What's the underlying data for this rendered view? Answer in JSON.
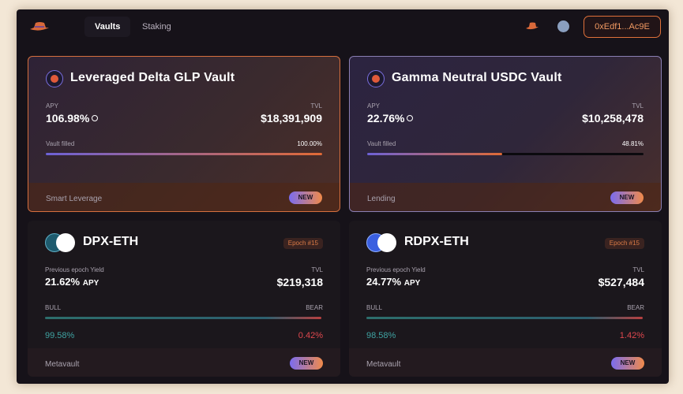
{
  "nav": {
    "tabs": [
      "Vaults",
      "Staking"
    ],
    "wallet": "0xEdf1...Ac9E",
    "icons": [
      "hat-logo-icon",
      "hat-icon",
      "network-icon"
    ]
  },
  "vaults": [
    {
      "title": "Leveraged Delta GLP Vault",
      "apy_label": "APY",
      "apy": "106.98%",
      "tvl_label": "TVL",
      "tvl": "$18,391,909",
      "filled_label": "Vault filled",
      "filled_pct": "100.00%",
      "filled_fraction": 1.0,
      "category": "Smart Leverage",
      "badge": "NEW"
    },
    {
      "title": "Gamma Neutral USDC Vault",
      "apy_label": "APY",
      "apy": "22.76%",
      "tvl_label": "TVL",
      "tvl": "$10,258,478",
      "filled_label": "Vault filled",
      "filled_pct": "48.81%",
      "filled_fraction": 0.4881,
      "category": "Lending",
      "badge": "NEW"
    }
  ],
  "dopex": [
    {
      "title": "DPX-ETH",
      "epoch": "Epoch #15",
      "yield_label": "Previous epoch Yield",
      "yield": "21.62%",
      "yield_unit": "APY",
      "tvl_label": "TVL",
      "tvl": "$219,318",
      "bull_label": "BULL",
      "bear_label": "BEAR",
      "bull_pct": "99.58%",
      "bear_pct": "0.42%",
      "category": "Metavault",
      "badge": "NEW"
    },
    {
      "title": "RDPX-ETH",
      "epoch": "Epoch #15",
      "yield_label": "Previous epoch Yield",
      "yield": "24.77%",
      "yield_unit": "APY",
      "tvl_label": "TVL",
      "tvl": "$527,484",
      "bull_label": "BULL",
      "bear_label": "BEAR",
      "bull_pct": "98.58%",
      "bear_pct": "1.42%",
      "category": "Metavault",
      "badge": "NEW"
    }
  ],
  "colors": {
    "accent_orange": "#e0713a",
    "accent_purple": "#7a6cf0",
    "bull": "#3fa3a2",
    "bear": "#e0484e"
  }
}
